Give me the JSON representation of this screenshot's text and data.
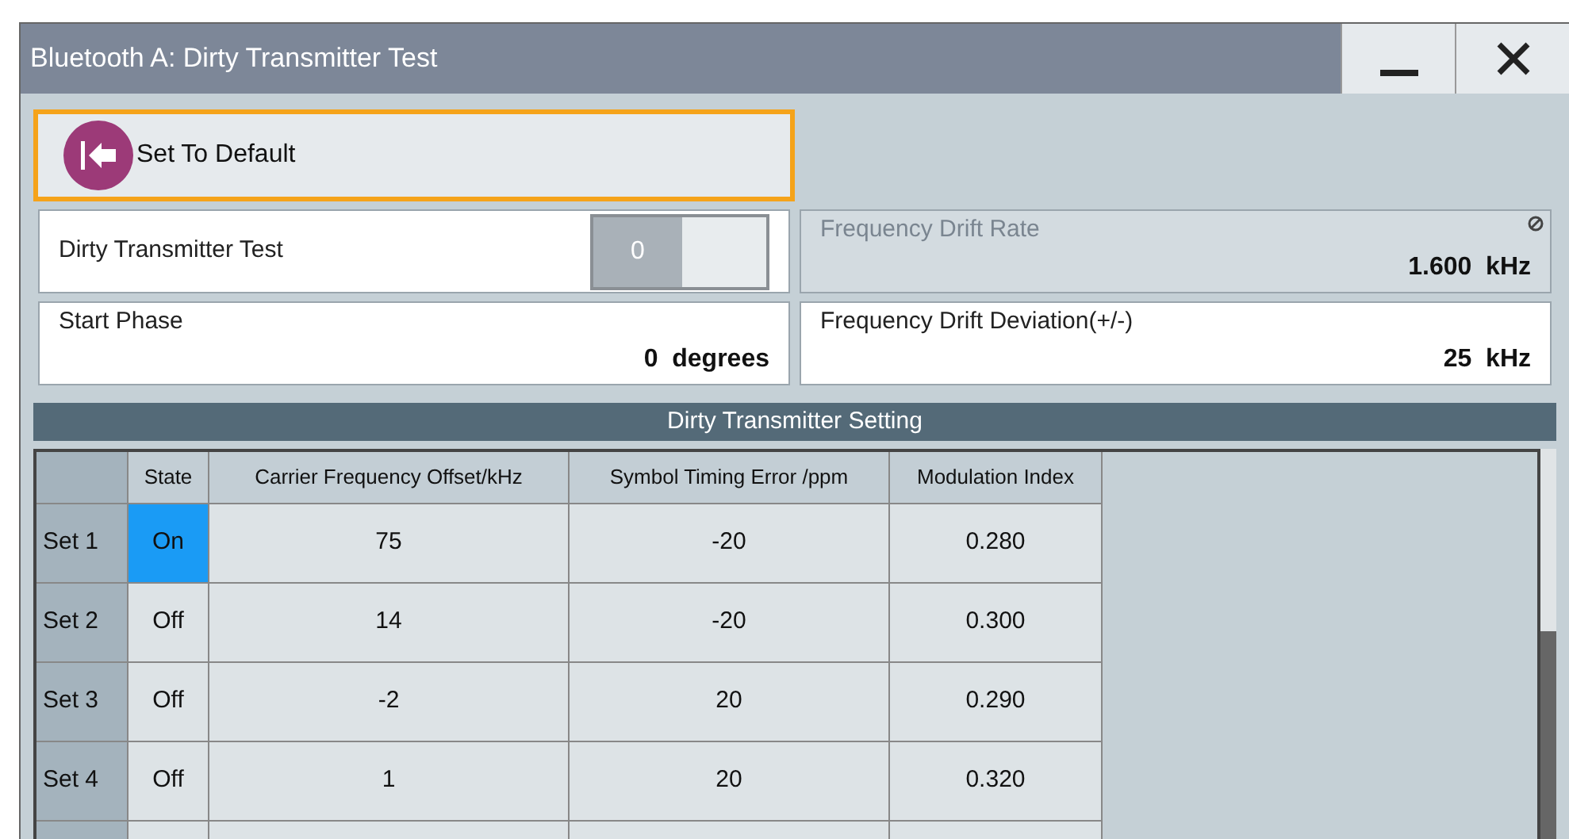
{
  "window": {
    "title": "Bluetooth A: Dirty Transmitter Test"
  },
  "default_button": {
    "label": "Set To Default",
    "focused": true
  },
  "dirty_transmitter_test": {
    "label": "Dirty Transmitter Test",
    "value": "0",
    "on": false
  },
  "frequency_drift_rate": {
    "label": "Frequency Drift Rate",
    "value": "1.600  kHz",
    "disabled": true
  },
  "start_phase": {
    "label": "Start Phase",
    "value": "0  degrees",
    "disabled": false
  },
  "frequency_drift_deviation": {
    "label": "Frequency Drift Deviation(+/-)",
    "value": "25  kHz",
    "disabled": false
  },
  "table": {
    "title": "Dirty Transmitter Setting",
    "columns": [
      "",
      "State",
      "Carrier Frequency Offset/kHz",
      "Symbol Timing Error /ppm",
      "Modulation Index"
    ],
    "rows": [
      {
        "cells": [
          "Set 1",
          "On",
          "75",
          "-20",
          "0.280"
        ],
        "selected": true
      },
      {
        "cells": [
          "Set 2",
          "Off",
          "14",
          "-20",
          "0.300"
        ],
        "selected": false
      },
      {
        "cells": [
          "Set 3",
          "Off",
          "-2",
          "20",
          "0.290"
        ],
        "selected": false
      },
      {
        "cells": [
          "Set 4",
          "Off",
          "1",
          "20",
          "0.320"
        ],
        "selected": false
      }
    ]
  }
}
